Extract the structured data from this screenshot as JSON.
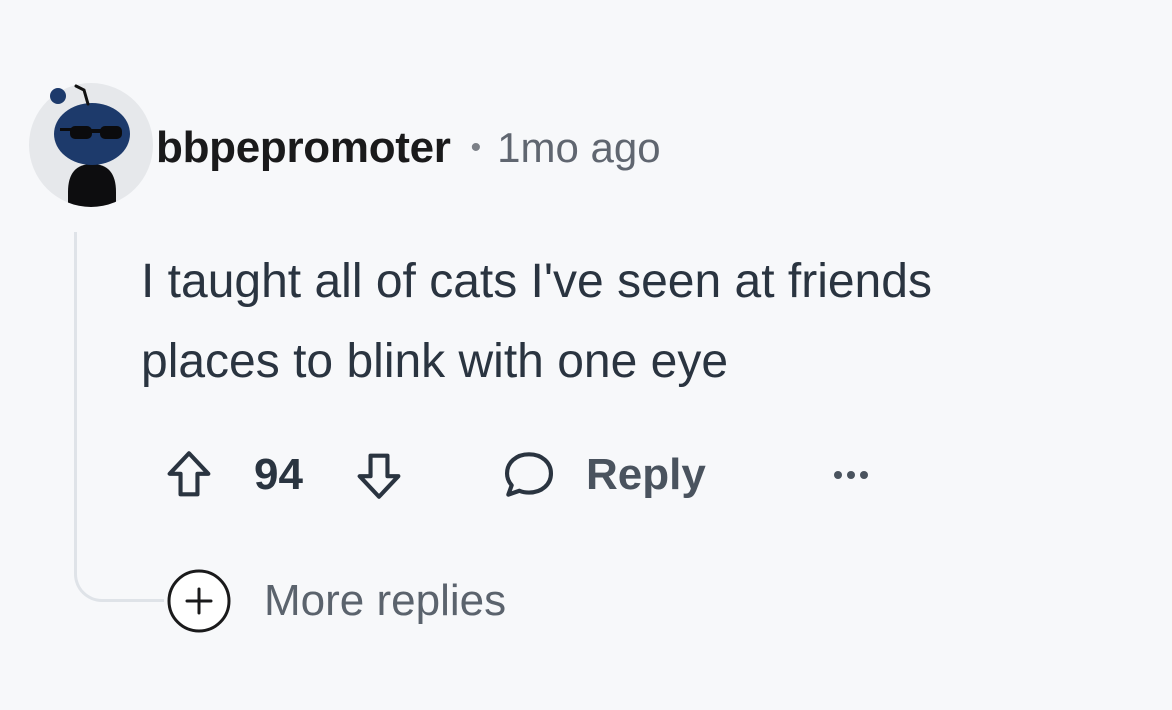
{
  "comment": {
    "author": "bbpepromoter",
    "separator": "•",
    "timestamp": "1mo ago",
    "body_lines": [
      "I taught all of cats I've seen at friends",
      "places to blink with one eye"
    ],
    "score": "94",
    "reply_label": "Reply",
    "more_replies_label": "More replies"
  },
  "icons": {
    "upvote": "upvote-arrow-icon",
    "downvote": "downvote-arrow-icon",
    "reply": "speech-bubble-icon",
    "more": "ellipsis-icon",
    "expand": "plus-circle-icon"
  },
  "colors": {
    "background": "#f7f8fa",
    "username": "#1a1a1b",
    "body_text": "#2a3440",
    "muted": "#5b636d",
    "thread_line": "#dfe3e8",
    "avatar_bg": "#e6e8eb",
    "avatar_head": "#1d3a6b"
  }
}
